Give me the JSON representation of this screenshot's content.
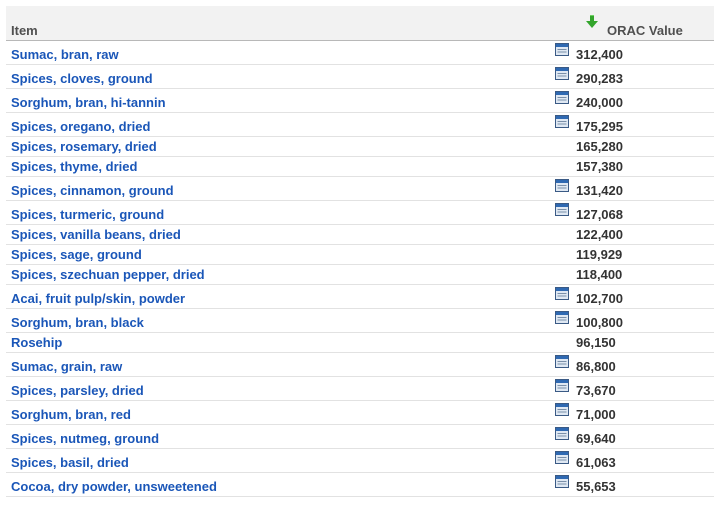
{
  "header": {
    "item_label": "Item",
    "value_label": "ORAC Value",
    "sort_icon": "sort-descending-arrow-icon"
  },
  "colors": {
    "link": "#1a56b8",
    "header_bg": "#f2f2f2",
    "sort_arrow": "#33a52c"
  },
  "rows": [
    {
      "name": "Sumac, bran, raw",
      "value": "312,400",
      "has_icon": true
    },
    {
      "name": "Spices, cloves, ground",
      "value": "290,283",
      "has_icon": true
    },
    {
      "name": "Sorghum, bran, hi-tannin",
      "value": "240,000",
      "has_icon": true
    },
    {
      "name": "Spices, oregano, dried",
      "value": "175,295",
      "has_icon": true
    },
    {
      "name": "Spices, rosemary, dried",
      "value": "165,280",
      "has_icon": false
    },
    {
      "name": "Spices, thyme, dried",
      "value": "157,380",
      "has_icon": false
    },
    {
      "name": "Spices, cinnamon, ground",
      "value": "131,420",
      "has_icon": true
    },
    {
      "name": "Spices, turmeric, ground",
      "value": "127,068",
      "has_icon": true
    },
    {
      "name": "Spices, vanilla beans, dried",
      "value": "122,400",
      "has_icon": false
    },
    {
      "name": "Spices, sage, ground",
      "value": "119,929",
      "has_icon": false
    },
    {
      "name": "Spices, szechuan pepper, dried",
      "value": "118,400",
      "has_icon": false
    },
    {
      "name": "Acai, fruit pulp/skin, powder",
      "value": "102,700",
      "has_icon": true
    },
    {
      "name": "Sorghum, bran, black",
      "value": "100,800",
      "has_icon": true
    },
    {
      "name": "Rosehip",
      "value": "96,150",
      "has_icon": false
    },
    {
      "name": "Sumac, grain, raw",
      "value": "86,800",
      "has_icon": true
    },
    {
      "name": "Spices, parsley, dried",
      "value": "73,670",
      "has_icon": true
    },
    {
      "name": "Sorghum, bran, red",
      "value": "71,000",
      "has_icon": true
    },
    {
      "name": "Spices, nutmeg, ground",
      "value": "69,640",
      "has_icon": true
    },
    {
      "name": "Spices, basil, dried",
      "value": "61,063",
      "has_icon": true
    },
    {
      "name": "Cocoa, dry powder, unsweetened",
      "value": "55,653",
      "has_icon": true
    }
  ]
}
